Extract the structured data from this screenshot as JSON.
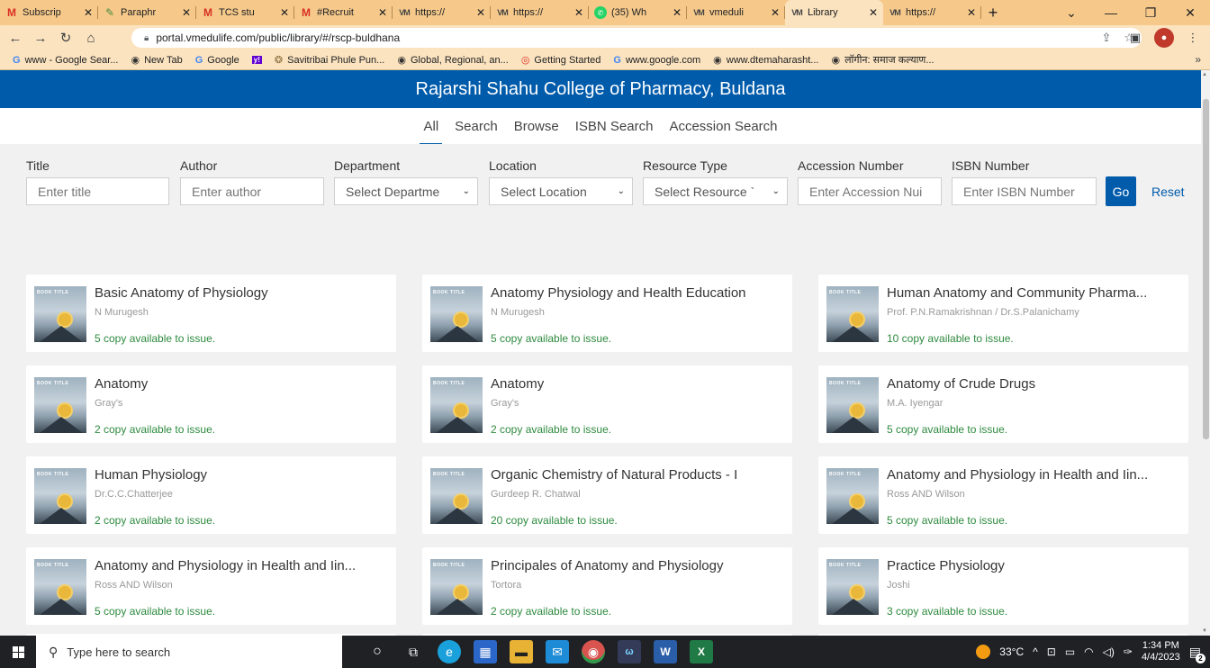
{
  "browser": {
    "tabs": [
      {
        "label": "Subscrip",
        "icon": "gmail-icon",
        "active": false
      },
      {
        "label": "Paraphr",
        "icon": "quillbot-icon",
        "active": false
      },
      {
        "label": "TCS stu",
        "icon": "gmail-icon",
        "active": false
      },
      {
        "label": "#Recruit",
        "icon": "gmail-icon",
        "active": false
      },
      {
        "label": "https://",
        "icon": "vmedulife-icon",
        "active": false
      },
      {
        "label": "https://",
        "icon": "vmedulife-icon",
        "active": false
      },
      {
        "label": "(35) Wh",
        "icon": "whatsapp-icon",
        "active": false
      },
      {
        "label": "vmeduli",
        "icon": "vmedulife-icon",
        "active": false
      },
      {
        "label": "Library",
        "icon": "vmedulife-icon",
        "active": true
      },
      {
        "label": "https://",
        "icon": "vmedulife-icon",
        "active": false
      }
    ],
    "url": "portal.vmedulife.com/public/library/#/rscp-buldhana",
    "bookmarks": [
      {
        "label": "www - Google Sear...",
        "icon": "google-icon"
      },
      {
        "label": "New Tab",
        "icon": "globe-icon"
      },
      {
        "label": "Google",
        "icon": "google-icon"
      },
      {
        "label": "",
        "icon": "yahoo-icon"
      },
      {
        "label": "Savitribai Phule Pun...",
        "icon": "university-icon"
      },
      {
        "label": "Global, Regional, an...",
        "icon": "globe-icon"
      },
      {
        "label": "Getting Started",
        "icon": "chrome-icon"
      },
      {
        "label": "www.google.com",
        "icon": "google-icon"
      },
      {
        "label": "www.dtemaharasht...",
        "icon": "globe-icon"
      },
      {
        "label": "लॉगीन: समाज कल्याण...",
        "icon": "globe-icon"
      }
    ]
  },
  "site": {
    "title": "Rajarshi Shahu College of Pharmacy, Buldana",
    "nav": [
      "All",
      "Search",
      "Browse",
      "ISBN Search",
      "Accession Search"
    ],
    "active_nav": "All"
  },
  "filters": {
    "title": {
      "label": "Title",
      "placeholder": "Enter title"
    },
    "author": {
      "label": "Author",
      "placeholder": "Enter author"
    },
    "department": {
      "label": "Department",
      "selected": "Select Departme"
    },
    "location": {
      "label": "Location",
      "selected": "Select Location"
    },
    "resource_type": {
      "label": "Resource Type",
      "selected": "Select Resource `"
    },
    "accession": {
      "label": "Accession Number",
      "placeholder": "Enter Accession Nui"
    },
    "isbn": {
      "label": "ISBN Number",
      "placeholder": "Enter ISBN Number"
    },
    "go_label": "Go",
    "reset_label": "Reset"
  },
  "cover_label": "BOOK TITLE",
  "books": [
    {
      "title": "Basic Anatomy of Physiology",
      "author": "N Murugesh",
      "availability": "5 copy available to issue."
    },
    {
      "title": "Anatomy Physiology and Health Education",
      "author": "N Murugesh",
      "availability": "5 copy available to issue."
    },
    {
      "title": "Human Anatomy and Community Pharma...",
      "author": "Prof. P.N.Ramakrishnan / Dr.S.Palanichamy",
      "availability": "10 copy available to issue."
    },
    {
      "title": "Anatomy",
      "author": "Gray's",
      "availability": "2 copy available to issue."
    },
    {
      "title": "Anatomy",
      "author": "Gray's",
      "availability": "2 copy available to issue."
    },
    {
      "title": "Anatomy of Crude Drugs",
      "author": "M.A. Iyengar",
      "availability": "5 copy available to issue."
    },
    {
      "title": "Human Physiology",
      "author": "Dr.C.C.Chatterjee",
      "availability": "2 copy available to issue."
    },
    {
      "title": "Organic Chemistry of Natural Products - I",
      "author": "Gurdeep R. Chatwal",
      "availability": "20 copy available to issue."
    },
    {
      "title": "Anatomy and Physiology in Health and Iin...",
      "author": "Ross AND Wilson",
      "availability": "5 copy available to issue."
    },
    {
      "title": "Anatomy and Physiology in Health and Iin...",
      "author": "Ross AND Wilson",
      "availability": "5 copy available to issue."
    },
    {
      "title": "Principales of Anatomy and Physiology",
      "author": "Tortora",
      "availability": "2 copy available to issue."
    },
    {
      "title": "Practice Physiology",
      "author": "Joshi",
      "availability": "3 copy available to issue."
    }
  ],
  "taskbar": {
    "search_placeholder": "Type here to search",
    "weather": "33°C",
    "time": "1:34 PM",
    "date": "4/4/2023",
    "notifications": "2"
  },
  "colors": {
    "header_blue": "#005bab",
    "availability_green": "#2d8a3e",
    "tabbar": "#f6c98a"
  }
}
